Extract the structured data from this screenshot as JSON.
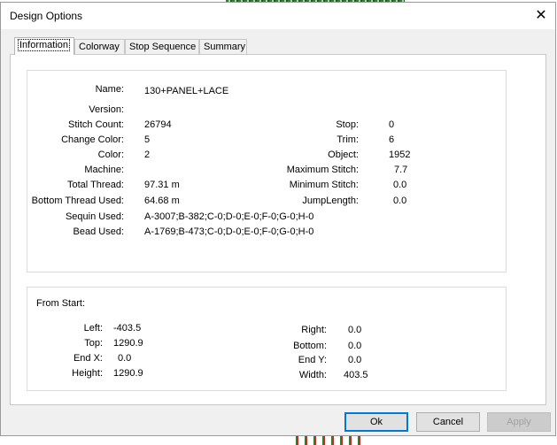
{
  "window": {
    "title": "Design Options",
    "close_glyph": "✕"
  },
  "tabs": [
    {
      "label": "Information",
      "active": true
    },
    {
      "label": "Colorway",
      "active": false
    },
    {
      "label": "Stop Sequence",
      "active": false
    },
    {
      "label": "Summary",
      "active": false
    }
  ],
  "info": {
    "name_label": "Name:",
    "name": "130+PANEL+LACE",
    "version_label": "Version:",
    "version": "",
    "stitch_count_label": "Stitch Count:",
    "stitch_count": "26794",
    "change_color_label": "Change Color:",
    "change_color": "5",
    "color_label": "Color:",
    "color": "2",
    "machine_label": "Machine:",
    "machine": "",
    "total_thread_label": "Total Thread:",
    "total_thread": "97.31 m",
    "bottom_thread_label": "Bottom Thread Used:",
    "bottom_thread": "64.68 m",
    "sequin_label": "Sequin Used:",
    "sequin": "A-3007;B-382;C-0;D-0;E-0;F-0;G-0;H-0",
    "bead_label": "Bead Used:",
    "bead": "A-1769;B-473;C-0;D-0;E-0;F-0;G-0;H-0",
    "stop_label": "Stop:",
    "stop": "0",
    "trim_label": "Trim:",
    "trim": "6",
    "object_label": "Object:",
    "object": "1952",
    "max_stitch_label": "Maximum Stitch:",
    "max_stitch": "7.7",
    "min_stitch_label": "Minimum Stitch:",
    "min_stitch": "0.0",
    "jump_length_label": "JumpLength:",
    "jump_length": "0.0"
  },
  "from_start": {
    "heading": "From Start:",
    "left_label": "Left:",
    "left": "-403.5",
    "top_label": "Top:",
    "top": "1290.9",
    "endx_label": "End X:",
    "endx": "0.0",
    "height_label": "Height:",
    "height": "1290.9",
    "right_label": "Right:",
    "right": "0.0",
    "bottom_label": "Bottom:",
    "bottom": "0.0",
    "endy_label": "End Y:",
    "endy": "0.0",
    "width_label": "Width:",
    "width": "403.5"
  },
  "buttons": {
    "ok": "Ok",
    "cancel": "Cancel",
    "apply": "Apply"
  }
}
